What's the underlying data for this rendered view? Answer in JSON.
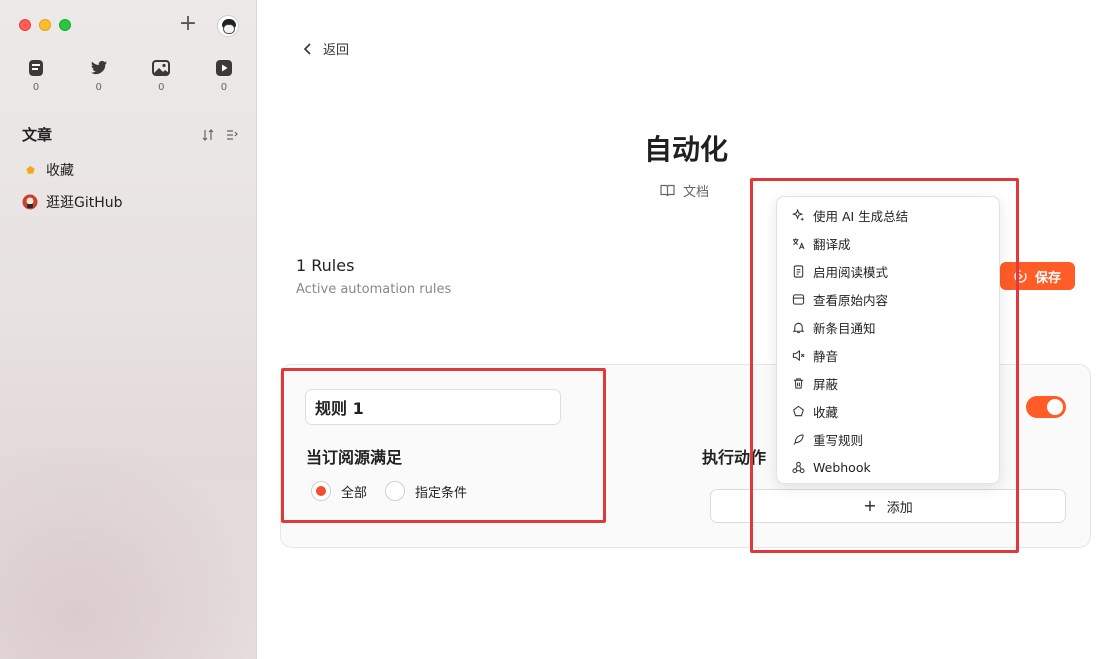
{
  "sidebar": {
    "categories": [
      {
        "icon": "article-icon",
        "count": "0"
      },
      {
        "icon": "twitter-icon",
        "count": "0"
      },
      {
        "icon": "picture-icon",
        "count": "0"
      },
      {
        "icon": "video-icon",
        "count": "0"
      }
    ],
    "section_title": "文章",
    "items": [
      {
        "label": "收藏",
        "icon": "star-icon"
      },
      {
        "label": "逛逛GitHub",
        "icon": "github-avatar-icon"
      }
    ]
  },
  "main": {
    "back_label": "返回",
    "title": "自动化",
    "docs_label": "文档",
    "rules_count": "1 Rules",
    "rules_subtitle": "Active automation rules",
    "save_label": "保存",
    "rule": {
      "name": "规则 1",
      "condition_label": "当订阅源满足",
      "options": [
        "全部",
        "指定条件"
      ],
      "selected": "全部",
      "actions_label": "执行动作",
      "add_label": "添加",
      "enabled": true
    }
  },
  "menu": {
    "items": [
      {
        "label": "使用 AI 生成总结",
        "icon": "sparkle-icon"
      },
      {
        "label": "翻译成",
        "icon": "translate-icon"
      },
      {
        "label": "启用阅读模式",
        "icon": "document-icon"
      },
      {
        "label": "查看原始内容",
        "icon": "browser-icon"
      },
      {
        "label": "新条目通知",
        "icon": "bell-icon"
      },
      {
        "label": "静音",
        "icon": "mute-icon"
      },
      {
        "label": "屏蔽",
        "icon": "trash-icon"
      },
      {
        "label": "收藏",
        "icon": "star-outline-icon"
      },
      {
        "label": "重写规则",
        "icon": "feather-icon"
      },
      {
        "label": "Webhook",
        "icon": "webhook-icon"
      }
    ]
  },
  "colors": {
    "accent": "#ff5c27",
    "annotation": "#e0393b"
  }
}
